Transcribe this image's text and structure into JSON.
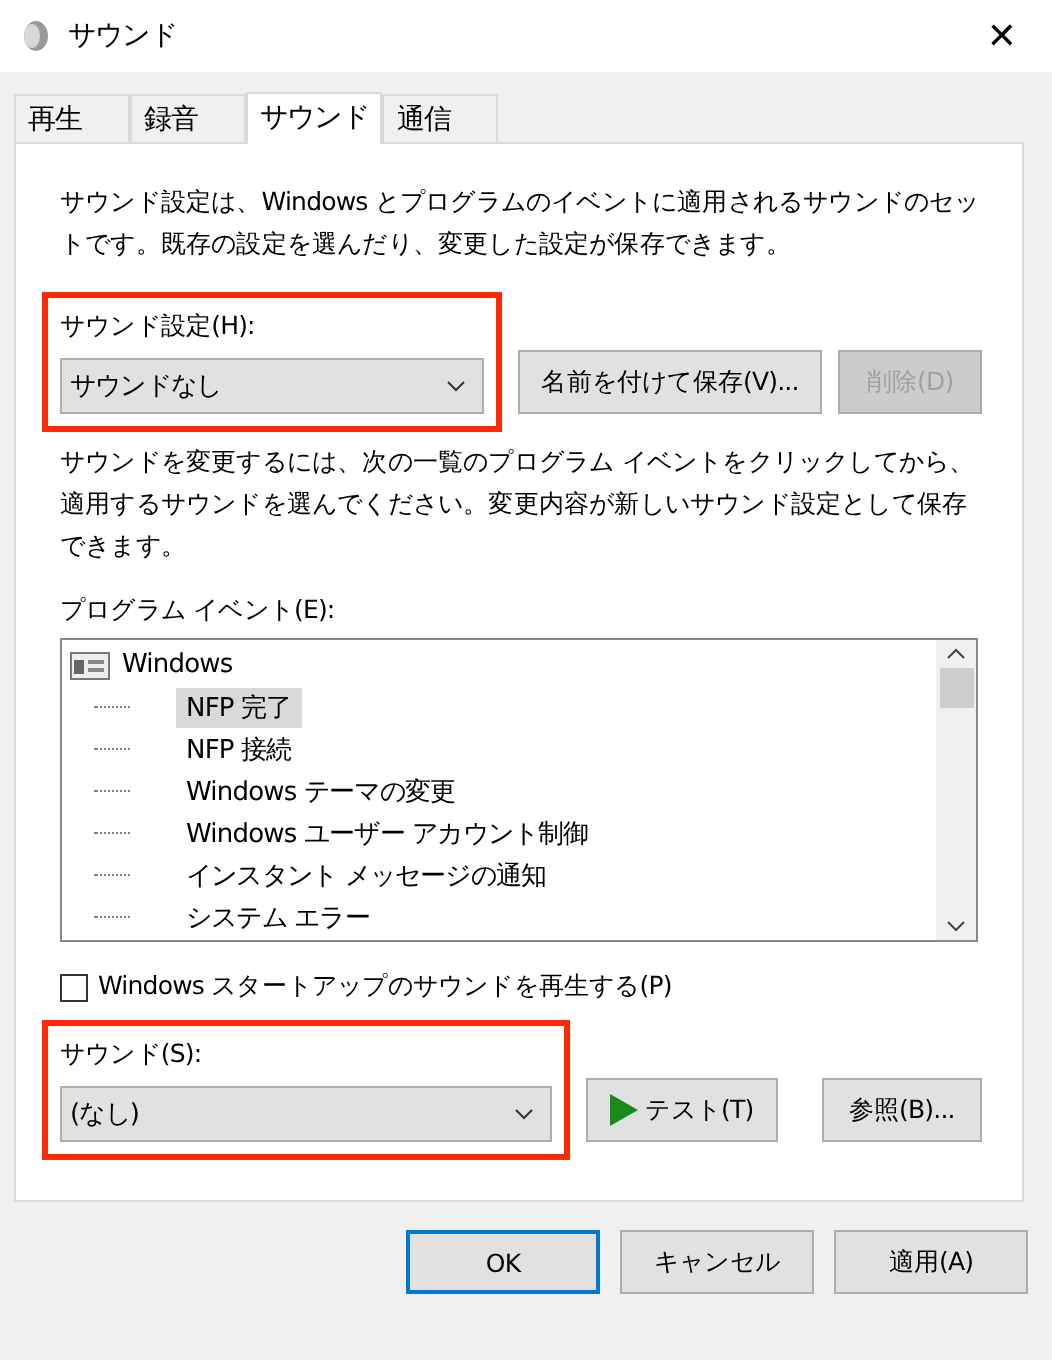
{
  "window": {
    "title": "サウンド",
    "close": "✕"
  },
  "tabs": [
    {
      "label": "再生",
      "selected": false
    },
    {
      "label": "録音",
      "selected": false
    },
    {
      "label": "サウンド",
      "selected": true
    },
    {
      "label": "通信",
      "selected": false
    }
  ],
  "intro": "サウンド設定は、Windows とプログラムのイベントに適用されるサウンドのセットです。既存の設定を選んだり、変更した設定が保存できます。",
  "scheme": {
    "label": "サウンド設定(H):",
    "value": "サウンドなし",
    "highlighted": true,
    "buttons": [
      {
        "label": "名前を付けて保存(V)...",
        "disabled": false
      },
      {
        "label": "削除(D)",
        "disabled": true
      }
    ]
  },
  "instructions": "サウンドを変更するには、次の一覧のプログラム イベントをクリックしてから、適用するサウンドを選んでください。変更内容が新しいサウンド設定として保存できます。",
  "events": {
    "label": "プログラム イベント(E):",
    "root": "Windows",
    "children": [
      {
        "label": "NFP 完了",
        "selected": true
      },
      {
        "label": "NFP 接続",
        "selected": false
      },
      {
        "label": "Windows テーマの変更",
        "selected": false
      },
      {
        "label": "Windows ユーザー アカウント制御",
        "selected": false
      },
      {
        "label": "インスタント メッセージの通知",
        "selected": false
      },
      {
        "label": "システム エラー",
        "selected": false
      }
    ]
  },
  "startup": {
    "label": "Windows スタートアップのサウンドを再生する(P)",
    "checked": false
  },
  "sound": {
    "label": "サウンド(S):",
    "value": "(なし)",
    "highlighted": true,
    "test": "テスト(T)",
    "browse": "参照(B)..."
  },
  "buttons": [
    {
      "label": "OK",
      "default": true
    },
    {
      "label": "キャンセル",
      "default": false
    },
    {
      "label": "適用(A)",
      "default": false
    }
  ]
}
